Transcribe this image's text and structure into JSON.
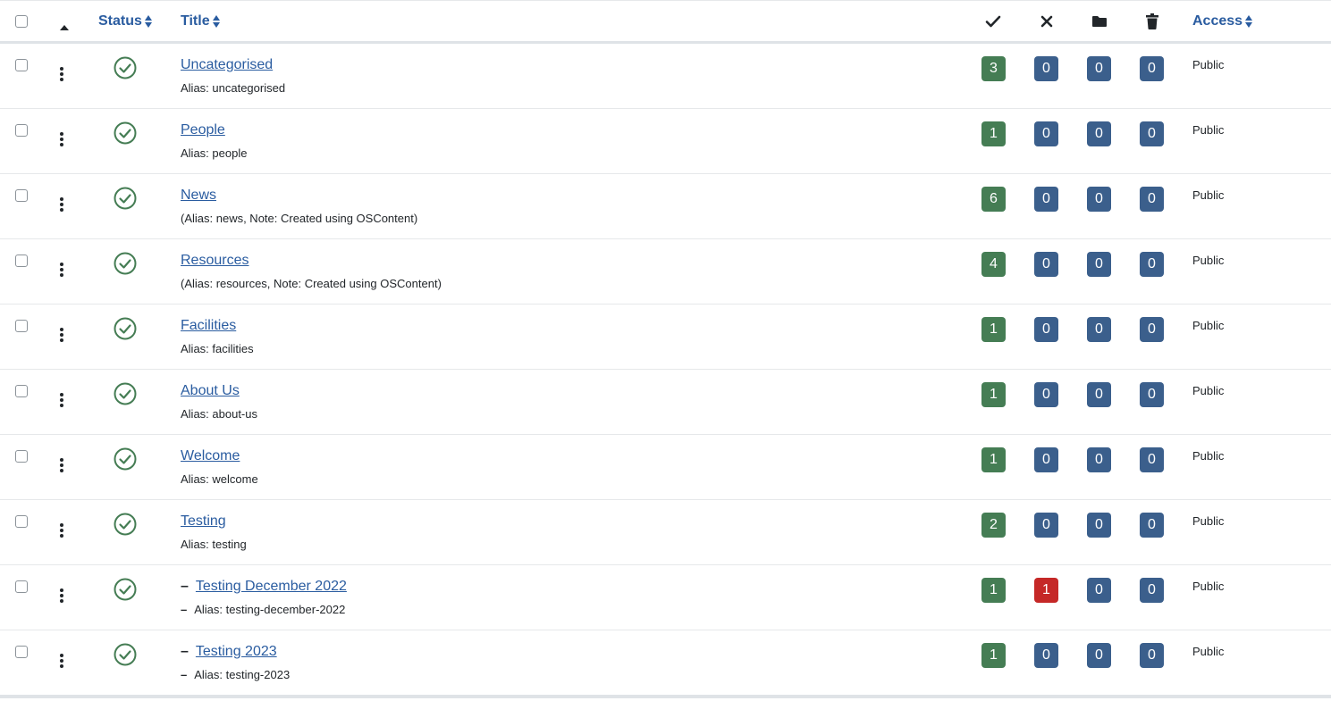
{
  "header": {
    "status_label": "Status",
    "title_label": "Title",
    "access_label": "Access",
    "icons": [
      "check-icon",
      "times-icon",
      "folder-icon",
      "trash-icon"
    ]
  },
  "colors": {
    "link": "#2a5ca0",
    "published": "#457d54",
    "neutral": "#3b5f8c",
    "unpublished_nonzero": "#c52827"
  },
  "rows": [
    {
      "title": "Uncategorised",
      "alias": "Alias: uncategorised",
      "dash": "",
      "counts": [
        "3",
        "0",
        "0",
        "0"
      ],
      "access": "Public"
    },
    {
      "title": "People",
      "alias": "Alias: people",
      "dash": "",
      "counts": [
        "1",
        "0",
        "0",
        "0"
      ],
      "access": "Public"
    },
    {
      "title": "News",
      "alias": "(Alias: news, Note: Created using OSContent)",
      "dash": "",
      "counts": [
        "6",
        "0",
        "0",
        "0"
      ],
      "access": "Public"
    },
    {
      "title": "Resources",
      "alias": "(Alias: resources, Note: Created using OSContent)",
      "dash": "",
      "counts": [
        "4",
        "0",
        "0",
        "0"
      ],
      "access": "Public"
    },
    {
      "title": "Facilities",
      "alias": "Alias: facilities",
      "dash": "",
      "counts": [
        "1",
        "0",
        "0",
        "0"
      ],
      "access": "Public"
    },
    {
      "title": "About Us",
      "alias": "Alias: about-us",
      "dash": "",
      "counts": [
        "1",
        "0",
        "0",
        "0"
      ],
      "access": "Public"
    },
    {
      "title": "Welcome",
      "alias": "Alias: welcome",
      "dash": "",
      "counts": [
        "1",
        "0",
        "0",
        "0"
      ],
      "access": "Public"
    },
    {
      "title": "Testing",
      "alias": "Alias: testing",
      "dash": "",
      "counts": [
        "2",
        "0",
        "0",
        "0"
      ],
      "access": "Public"
    },
    {
      "title": "Testing December 2022",
      "alias": "Alias: testing-december-2022",
      "dash": "–",
      "counts": [
        "1",
        "1",
        "0",
        "0"
      ],
      "access": "Public"
    },
    {
      "title": "Testing 2023",
      "alias": "Alias: testing-2023",
      "dash": "–",
      "counts": [
        "1",
        "0",
        "0",
        "0"
      ],
      "access": "Public"
    }
  ]
}
